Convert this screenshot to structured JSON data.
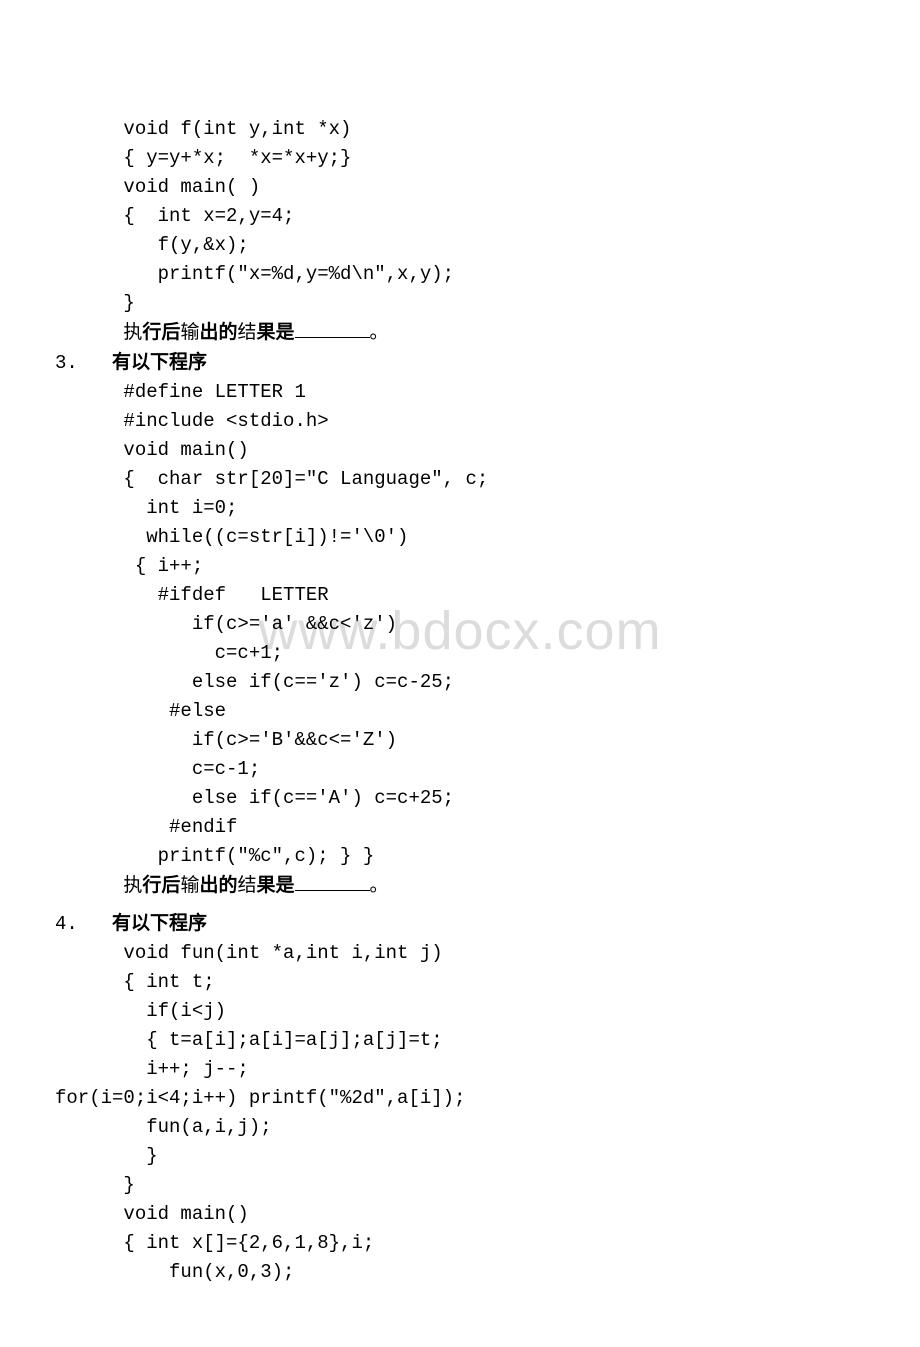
{
  "watermark": "www.bdocx.com",
  "block2": {
    "l1": "      void f(int y,int *x)",
    "l2": "      { y=y+*x;  *x=*x+y;}",
    "l3": "      void main( )",
    "l4": "      {  int x=2,y=4;",
    "l5": "         f(y,&x);",
    "l6": "         printf(\"x=%d,y=%d\\n\",x,y);",
    "l7": "      }",
    "l8a": "      执",
    "l8b": "行后",
    "l8c": "输",
    "l8d": "出的",
    "l8e": "结",
    "l8f": "果是",
    "l8g": "。"
  },
  "q3": {
    "num": "3.   ",
    "title": "有以下程序",
    "l1": "      #define LETTER 1",
    "l2": "      #include <stdio.h>",
    "l3": "      void main()",
    "l4": "      {  char str[20]=\"C Language\", c;",
    "l5": "        int i=0;",
    "l6": "        while((c=str[i])!='\\0')",
    "l7": "       { i++;",
    "l8": "         #ifdef   LETTER",
    "l9": "            if(c>='a' &&c<'z')",
    "l10": "              c=c+1;",
    "l11": "            else if(c=='z') c=c-25;",
    "l12": "          #else",
    "l13": "            if(c>='B'&&c<='Z')",
    "l14": "            c=c-1;",
    "l15": "            else if(c=='A') c=c+25;",
    "l16": "          #endif",
    "l17": "         printf(\"%c\",c); } }",
    "l18a": "      执",
    "l18b": "行后",
    "l18c": "输",
    "l18d": "出的",
    "l18e": "结",
    "l18f": "果是",
    "l18g": "。"
  },
  "q4": {
    "num": "4.   ",
    "title": "有以下程序",
    "l1": "      void fun(int *a,int i,int j)",
    "l2": "      { int t;",
    "l3": "        if(i<j)",
    "l4": "        { t=a[i];a[i]=a[j];a[j]=t;",
    "l5": "        i++; j--;",
    "l6": "for(i=0;i<4;i++) printf(\"%2d\",a[i]);",
    "l7": "        fun(a,i,j);",
    "l8": "        }",
    "l9": "      }",
    "l10": "      void main()",
    "l11": "      { int x[]={2,6,1,8},i;",
    "l12": "          fun(x,0,3);"
  }
}
